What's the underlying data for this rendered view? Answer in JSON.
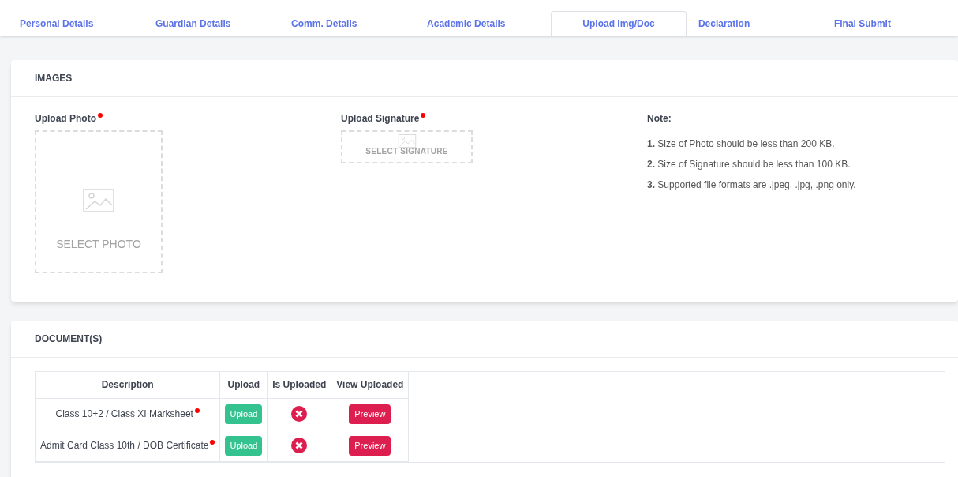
{
  "tabs": [
    {
      "label": "Personal Details",
      "selected": false
    },
    {
      "label": "Guardian Details",
      "selected": false
    },
    {
      "label": "Comm. Details",
      "selected": false
    },
    {
      "label": "Academic Details",
      "selected": false
    },
    {
      "label": "Upload Img/Doc",
      "selected": true
    },
    {
      "label": "Declaration",
      "selected": false
    },
    {
      "label": "Final Submit",
      "selected": false
    }
  ],
  "images": {
    "title": "IMAGES",
    "photo": {
      "label": "Upload Photo",
      "required": true,
      "placeholder": "SELECT PHOTO"
    },
    "signature": {
      "label": "Upload Signature",
      "required": true,
      "placeholder": "SELECT SIGNATURE"
    },
    "note": {
      "title": "Note:",
      "items": [
        "**1.** Size of Photo should be less than 200 KB.",
        "**2.** Size of Signature should be less than 100 KB.",
        "**3.** Supported file formats are .jpeg, .jpg, .png only."
      ]
    }
  },
  "documents": {
    "title": "DOCUMENT(S)",
    "columns": [
      "Description",
      "Upload",
      "Is Uploaded",
      "View Uploaded"
    ],
    "rows": [
      {
        "description": "Class 10+2 / Class XI Marksheet",
        "required": true,
        "upload": "Upload",
        "uploaded": false,
        "view": "Preview"
      },
      {
        "description": "Admit Card Class 10th / DOB Certificate",
        "required": true,
        "upload": "Upload",
        "uploaded": false,
        "view": "Preview"
      }
    ]
  }
}
